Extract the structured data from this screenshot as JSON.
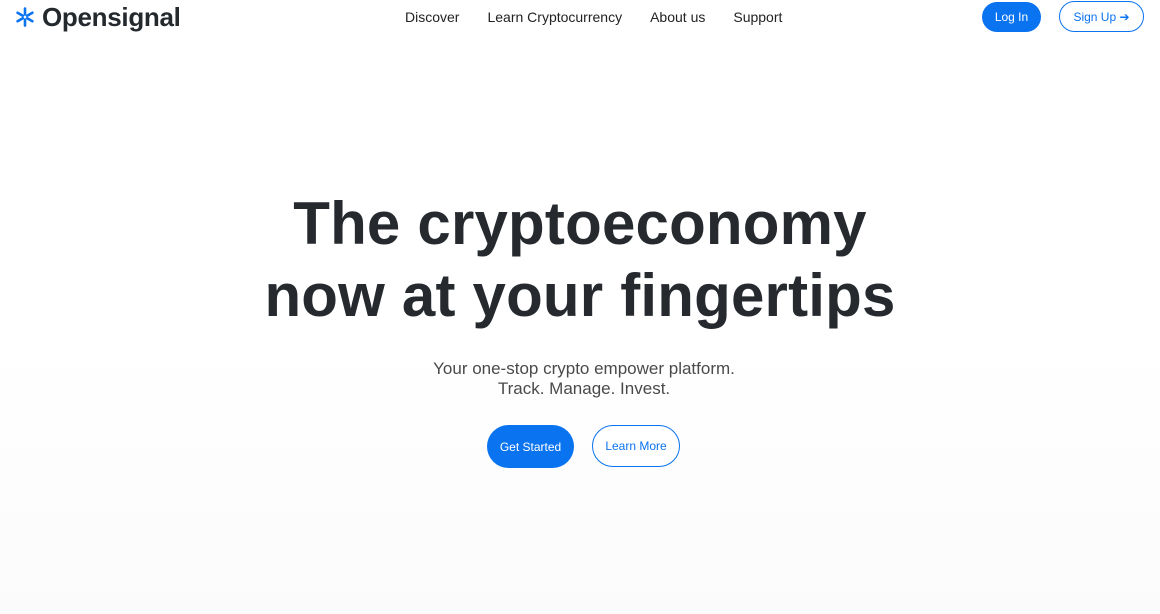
{
  "brand": {
    "name": "Opensignal",
    "icon": "asterisk-logo-icon",
    "color": "#0a73f0"
  },
  "nav": {
    "items": [
      {
        "label": "Discover"
      },
      {
        "label": "Learn Cryptocurrency"
      },
      {
        "label": "About us"
      },
      {
        "label": "Support"
      }
    ]
  },
  "auth": {
    "login_label": "Log In",
    "signup_label": "Sign Up ➔"
  },
  "hero": {
    "title_line1": "The cryptoeconomy",
    "title_line2": "now at your fingertips",
    "subtitle_line1": "Your one-stop crypto empower platform.",
    "subtitle_line2": "Track. Manage. Invest.",
    "primary_cta": "Get Started",
    "secondary_cta": "Learn More"
  },
  "colors": {
    "accent": "#0a73f0",
    "text": "#262a2f",
    "background": "#ffffff"
  }
}
